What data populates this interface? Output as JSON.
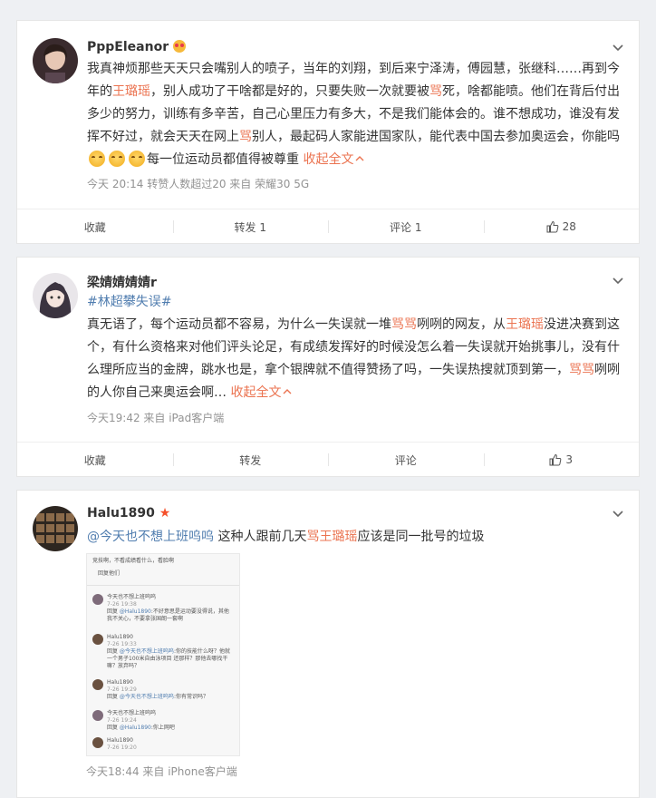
{
  "posts": [
    {
      "username": "PppEleanor",
      "badge_icon": "heart-eyes-emoji-icon",
      "text_parts": [
        {
          "t": "我真神烦那些天天只会嘴别人的喷子，当年的刘翔，到后来宁泽涛，傅园慧，张继科……再到今年的",
          "c": ""
        },
        {
          "t": "王璐瑶",
          "c": "hl"
        },
        {
          "t": "，别人成功了干啥都是好的，只要失败一次就要被",
          "c": ""
        },
        {
          "t": "骂",
          "c": "hl"
        },
        {
          "t": "死，啥都能喷。他们在背后付出多少的努力，训练有多辛苦，自己心里压力有多大，不是我们能体会的。谁不想成功，谁没有发挥不好过，就会天天在网上",
          "c": ""
        },
        {
          "t": "骂",
          "c": "hl"
        },
        {
          "t": "别人，最起码人家能进国家队，能代表中国去参加奥运会，你能吗",
          "c": ""
        }
      ],
      "text_tail": "每一位运动员都值得被尊重",
      "expand": "收起全文",
      "meta": "今天 20:14 转赞人数超过20  来自 荣耀30 5G",
      "actions": {
        "favorite": "收藏",
        "repost": "转发 1",
        "comment": "评论 1",
        "like": "28"
      }
    },
    {
      "username": "梁婧婧婧婧r",
      "topic": "#林超攀失误#",
      "text_parts": [
        {
          "t": "真无语了，每个运动员都不容易，为什么一失误就一堆",
          "c": ""
        },
        {
          "t": "骂骂",
          "c": "hl"
        },
        {
          "t": "咧咧的网友，从",
          "c": ""
        },
        {
          "t": "王璐瑶",
          "c": "hl"
        },
        {
          "t": "没进决赛到这个，有什么资格来对他们评头论足，有成绩发挥好的时候没怎么着一失误就开始挑事儿，没有什么理所应当的金牌，跳水也是，拿个银牌就不值得赞扬了吗，一失误热搜就顶到第一，",
          "c": ""
        },
        {
          "t": "骂骂",
          "c": "hl"
        },
        {
          "t": "咧咧的人你自己来奥运会啊…",
          "c": ""
        }
      ],
      "expand": "收起全文",
      "meta": "今天19:42  来自 iPad客户端",
      "actions": {
        "favorite": "收藏",
        "repost": "转发",
        "comment": "评论",
        "like": "3"
      }
    },
    {
      "username": "Halu1890",
      "mention": "@今天也不想上班呜呜",
      "text_mid": " 这种人跟前几天",
      "hl1": "骂王璐瑶",
      "text_end": "应该是同一批号的垃圾",
      "meta": "今天18:44  来自 iPhone客户端",
      "screenshot": {
        "line1": "竞技啊，不看成绩看什么，看脸啊",
        "line2": "回复他们",
        "u1": "今天也不想上班呜呜",
        "t1": "7-26 19:38",
        "c1a": "回复 ",
        "c1m": "@Halu1890",
        "c1b": ":不好意思是运动要没得说，其他我不关心，不要拿张国朗一套啊",
        "u2": "Halu1890",
        "t2": "7-26 19:33",
        "c2a": "回复 ",
        "c2m": "@今天也不想上班呜呜",
        "c2b": ":你的技能什么呀？他就一个男子100米自由泳项目 还那样？那他去哪找干嘛？放弃吗？",
        "u3": "Halu1890",
        "t3": "7-26 19:29",
        "c3a": "回复 ",
        "c3m": "@今天也不想上班呜呜",
        "c3b": ":你有常识吗？",
        "u4": "今天也不想上班呜呜",
        "t4": "7-26 19:24",
        "c4a": "回复 ",
        "c4m": "@Halu1890",
        "c4b": ":你上网吧",
        "u5": "Halu1890",
        "t5": "7-26 19:20"
      }
    }
  ]
}
